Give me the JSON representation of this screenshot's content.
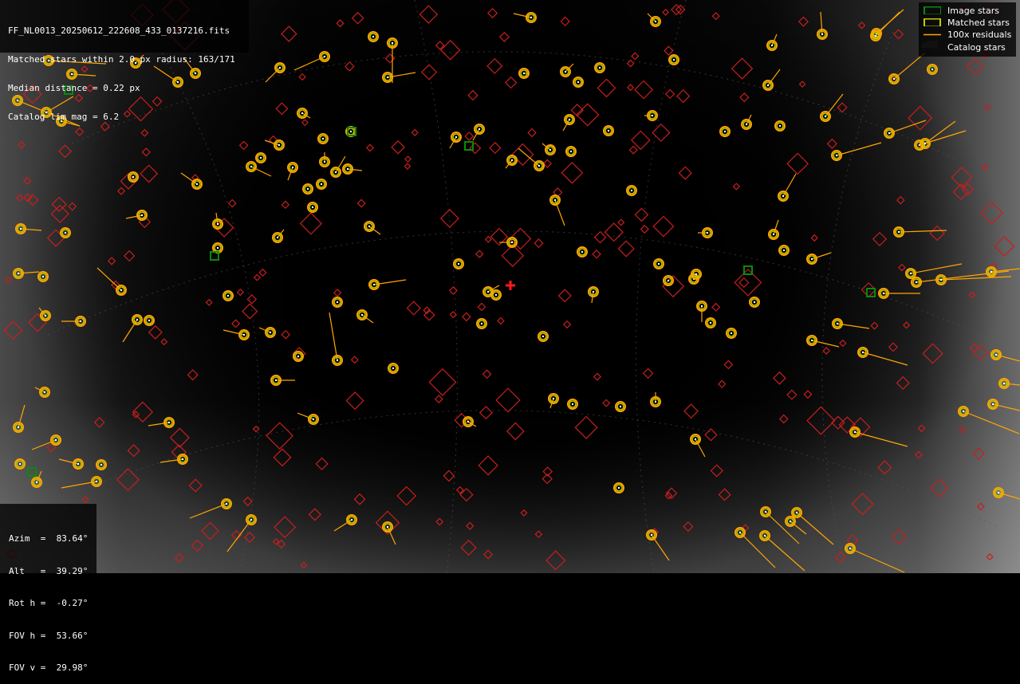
{
  "file_info": {
    "lines": [
      "FF_NL0013_20250612_222608_433_0137216.fits",
      "Matched stars within 2.0 px radius: 163/171",
      "Median distance = 0.22 px",
      "Catalog lim mag = 6.2"
    ]
  },
  "pointing": {
    "lines": [
      "Azim  =  83.64°",
      "Alt   =  39.29°",
      "Rot h =  -0.27°",
      "FOV h =  53.66°",
      "FOV v =  29.98°"
    ]
  },
  "legend": {
    "items": [
      {
        "label": "Image stars",
        "symbol": "green-square-icon",
        "color": "#0a8a0a"
      },
      {
        "label": "Matched stars",
        "symbol": "yellow-rect-icon",
        "color": "#c8c800"
      },
      {
        "label": "100x residuals",
        "symbol": "orange-line-icon",
        "color": "#ffa500"
      },
      {
        "label": "Catalog stars",
        "symbol": "dark-circle-icon",
        "color": "#111111"
      }
    ]
  },
  "colors": {
    "catalog_marker": "#c81e1e",
    "image_star": "#0a8a0a",
    "matched_star": "#c8c800",
    "residual": "#ffa500",
    "center_cross": "#ff1a1a"
  }
}
